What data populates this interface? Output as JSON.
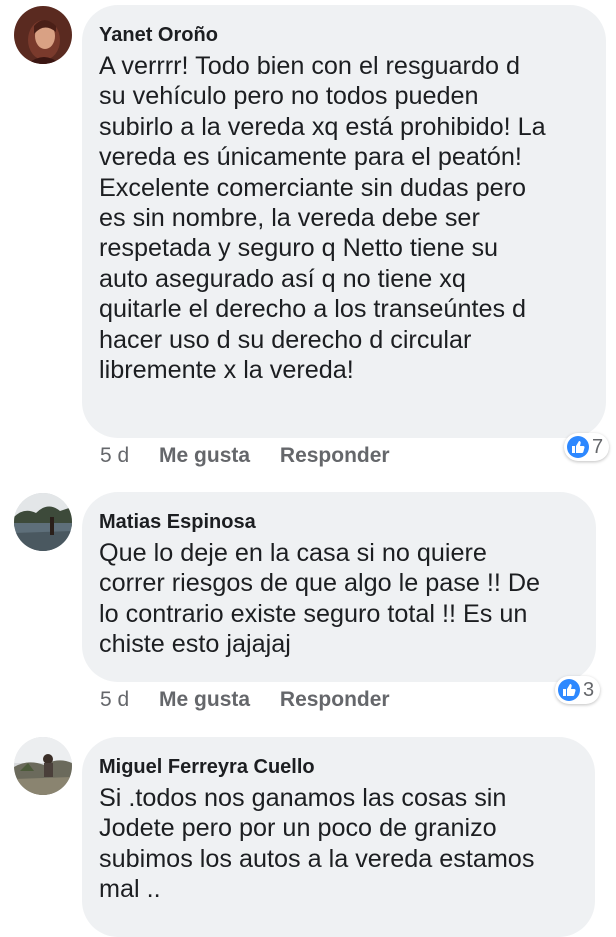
{
  "colors": {
    "bubble": "#eff1f3",
    "like": "#2d88ff",
    "meta_text": "#65676b",
    "text": "#1c1e21"
  },
  "comments": [
    {
      "author": "Yanet Oroño",
      "text_lines": [
        "A verrrr! Todo bien con el resguardo d",
        "su vehículo pero no todos pueden",
        "subirlo a la vereda xq está prohibido! La",
        "vereda es únicamente para el peatón!",
        "Excelente comerciante sin dudas pero",
        "es sin nombre, la vereda debe ser",
        "respetada y seguro q Netto tiene su",
        "auto asegurado así q no tiene xq",
        "quitarle el derecho a los transeúntes d",
        "hacer uso d su derecho d circular",
        "libremente x la vereda!"
      ],
      "time": "5 d",
      "like_label": "Me gusta",
      "reply_label": "Responder",
      "reaction_icon": "like-icon",
      "reaction_count": "7"
    },
    {
      "author": "Matias Espinosa",
      "text_lines": [
        "Que lo deje en la casa si no quiere",
        "correr riesgos de que algo le pase !! De",
        "lo contrario existe seguro total !! Es un",
        "chiste esto jajajaj"
      ],
      "time": "5 d",
      "like_label": "Me gusta",
      "reply_label": "Responder",
      "reaction_icon": "like-icon",
      "reaction_count": "3"
    },
    {
      "author": "Miguel Ferreyra Cuello",
      "text_lines": [
        "Si .todos nos ganamos las cosas sin",
        "Jodete pero por un poco de granizo",
        "subimos los autos a la vereda estamos",
        "mal .."
      ]
    }
  ]
}
